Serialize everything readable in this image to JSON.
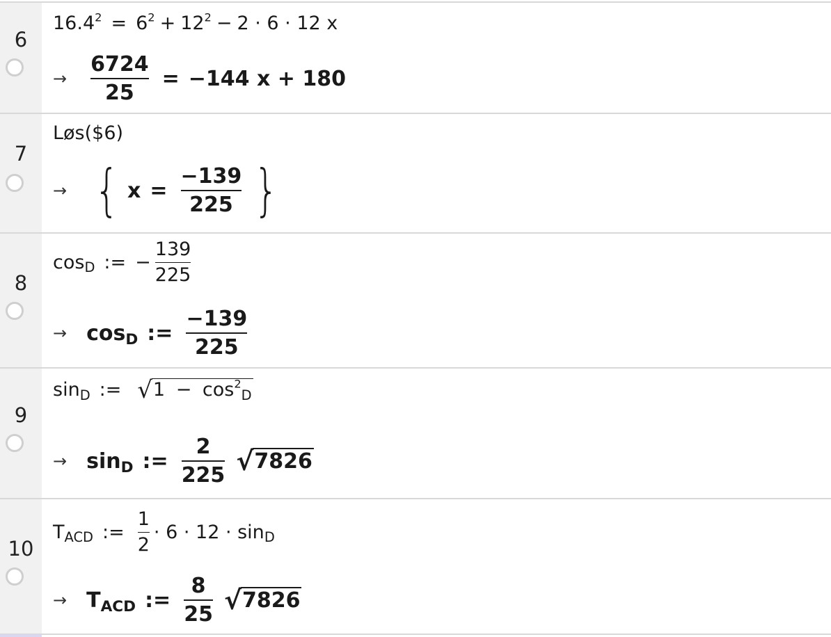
{
  "rows": [
    {
      "number": "6",
      "input": {
        "lhs": "16.4",
        "lhs_exp": "2",
        "eq": "=",
        "t1": "6",
        "t1_exp": "2",
        "plus": "+",
        "t2": "12",
        "t2_exp": "2",
        "minus": "−",
        "tail": "2 · 6 · 12 x"
      },
      "output": {
        "arrow": "→",
        "num": "6724",
        "den": "25",
        "eq": "=",
        "rhs": "−144 x + 180"
      }
    },
    {
      "number": "7",
      "input": {
        "text": "Løs($6)"
      },
      "output": {
        "arrow": "→",
        "open": "{",
        "var": "x",
        "eq": "=",
        "num": "−139",
        "den": "225",
        "close": "}"
      }
    },
    {
      "number": "8",
      "input": {
        "name": "cos",
        "sub": "D",
        "assign": ":=",
        "sign": "−",
        "num": "139",
        "den": "225"
      },
      "output": {
        "arrow": "→",
        "name": "cos",
        "sub": "D",
        "assign": ":=",
        "num": "−139",
        "den": "225"
      }
    },
    {
      "number": "9",
      "input": {
        "name": "sin",
        "sub": "D",
        "assign": ":=",
        "radical": "√",
        "one": "1",
        "minus": "−",
        "cos": "cos",
        "cos_exp": "2",
        "cos_sub": "D"
      },
      "output": {
        "arrow": "→",
        "name": "sin",
        "sub": "D",
        "assign": ":=",
        "num": "2",
        "den": "225",
        "radical": "√",
        "radicand": "7826"
      }
    },
    {
      "number": "10",
      "input": {
        "name": "T",
        "sub": "ACD",
        "assign": ":=",
        "num": "1",
        "den": "2",
        "tail": "· 6 · 12 · sin",
        "tail_sub": "D"
      },
      "output": {
        "arrow": "→",
        "name": "T",
        "sub": "ACD",
        "assign": ":=",
        "num": "8",
        "den": "25",
        "radical": "√",
        "radicand": "7826"
      }
    }
  ]
}
